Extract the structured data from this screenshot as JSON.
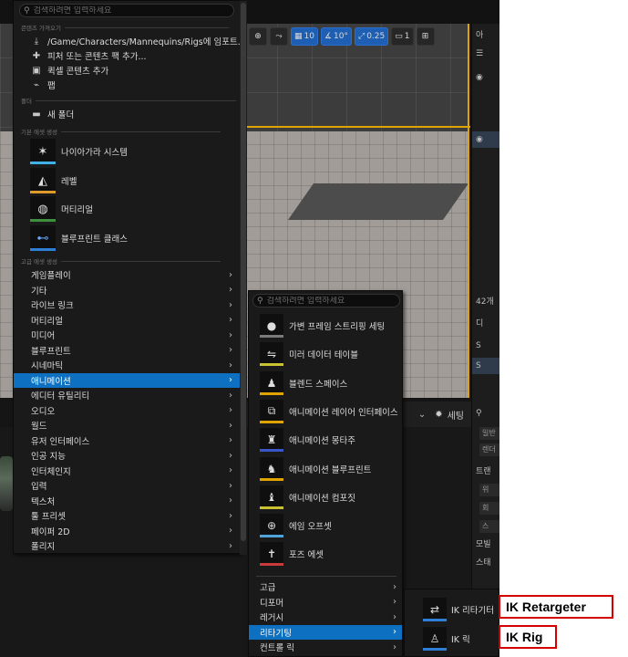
{
  "viewport_toolbar": {
    "grid_value": "10",
    "angle_value": "10°",
    "scale_value": "0.25",
    "camera_speed": "1"
  },
  "right_panel": {
    "top_label": "아",
    "count_label": "42개",
    "details_label": "디",
    "item1_label": "S",
    "item2_label": "S",
    "chip1": "일반",
    "chip2": "렌더",
    "row_transform": "트랜",
    "field1": "위",
    "field2": "회",
    "field3": "스",
    "mobility": "모빌",
    "static_label": "스태"
  },
  "lower_toolbar": {
    "settings_label": "세팅"
  },
  "menu1": {
    "search_placeholder": "검색하려면 입력하세요",
    "sections": {
      "get_content": "콘텐츠 가져오기",
      "folder": "폴더",
      "basic_assets": "기본 에셋 생성",
      "advanced_assets": "고급 에셋 생성"
    },
    "get_content_items": [
      {
        "label": "/Game/Characters/Mannequins/Rigs에 임포트...",
        "icon": "import-icon"
      },
      {
        "label": "피처 또는 콘텐츠 팩 추가...",
        "icon": "content-pack-icon"
      },
      {
        "label": "퀵셀 콘텐츠 추가",
        "icon": "quixel-icon"
      },
      {
        "label": "팹",
        "icon": "fab-icon"
      }
    ],
    "new_folder_label": "새 폴더",
    "basic_assets": [
      {
        "label": "나이아가라 시스템",
        "color": "#3fb1e6",
        "icon": "niagara-icon"
      },
      {
        "label": "레벨",
        "color": "#e09a2b",
        "icon": "level-icon"
      },
      {
        "label": "머티리얼",
        "color": "#3d8f3d",
        "icon": "material-icon"
      },
      {
        "label": "블루프린트 클래스",
        "color": "#2f7fd8",
        "icon": "blueprint-icon"
      }
    ],
    "categories": [
      "게임플레이",
      "기타",
      "라이브 링크",
      "머티리얼",
      "미디어",
      "블루프린트",
      "시네마틱",
      "애니메이션",
      "에디터 유틸리티",
      "오디오",
      "월드",
      "유저 인터페이스",
      "인공 지능",
      "인터체인지",
      "입력",
      "텍스처",
      "툴 프리셋",
      "페이퍼 2D",
      "폴리지"
    ],
    "selected_category": "애니메이션"
  },
  "menu2": {
    "search_placeholder": "검색하려면 입력하세요",
    "assets": [
      {
        "label": "가변 프레임 스트리핑 세팅",
        "color": "#7a7a7a",
        "icon": "sphere-icon"
      },
      {
        "label": "미러 데이터 테이블",
        "color": "#c9c032",
        "icon": "mirror-icon"
      },
      {
        "label": "블렌드 스페이스",
        "color": "#e0a400",
        "icon": "blend-space-icon"
      },
      {
        "label": "애니메이션 레이어 인터페이스",
        "color": "#e0a400",
        "icon": "layer-interface-icon"
      },
      {
        "label": "애니메이션 몽타주",
        "color": "#3a57c9",
        "icon": "montage-icon"
      },
      {
        "label": "애니메이션 블루프린트",
        "color": "#e0a400",
        "icon": "anim-blueprint-icon"
      },
      {
        "label": "애니메이션 컴포짓",
        "color": "#c9c032",
        "icon": "composite-icon"
      },
      {
        "label": "에임 오프셋",
        "color": "#4fa3d9",
        "icon": "aim-offset-icon"
      },
      {
        "label": "포즈 에셋",
        "color": "#c93a3a",
        "icon": "pose-asset-icon"
      }
    ],
    "categories": [
      "고급",
      "디포머",
      "레거시",
      "리타기팅",
      "컨트롤 릭"
    ],
    "selected_category": "리타기팅"
  },
  "menu3": {
    "items": [
      {
        "label": "IK 리타기터",
        "icon": "ik-retargeter-icon"
      },
      {
        "label": "IK 릭",
        "icon": "ik-rig-icon"
      }
    ]
  },
  "callouts": {
    "retargeter": "IK Retargeter",
    "rig": "IK Rig"
  }
}
